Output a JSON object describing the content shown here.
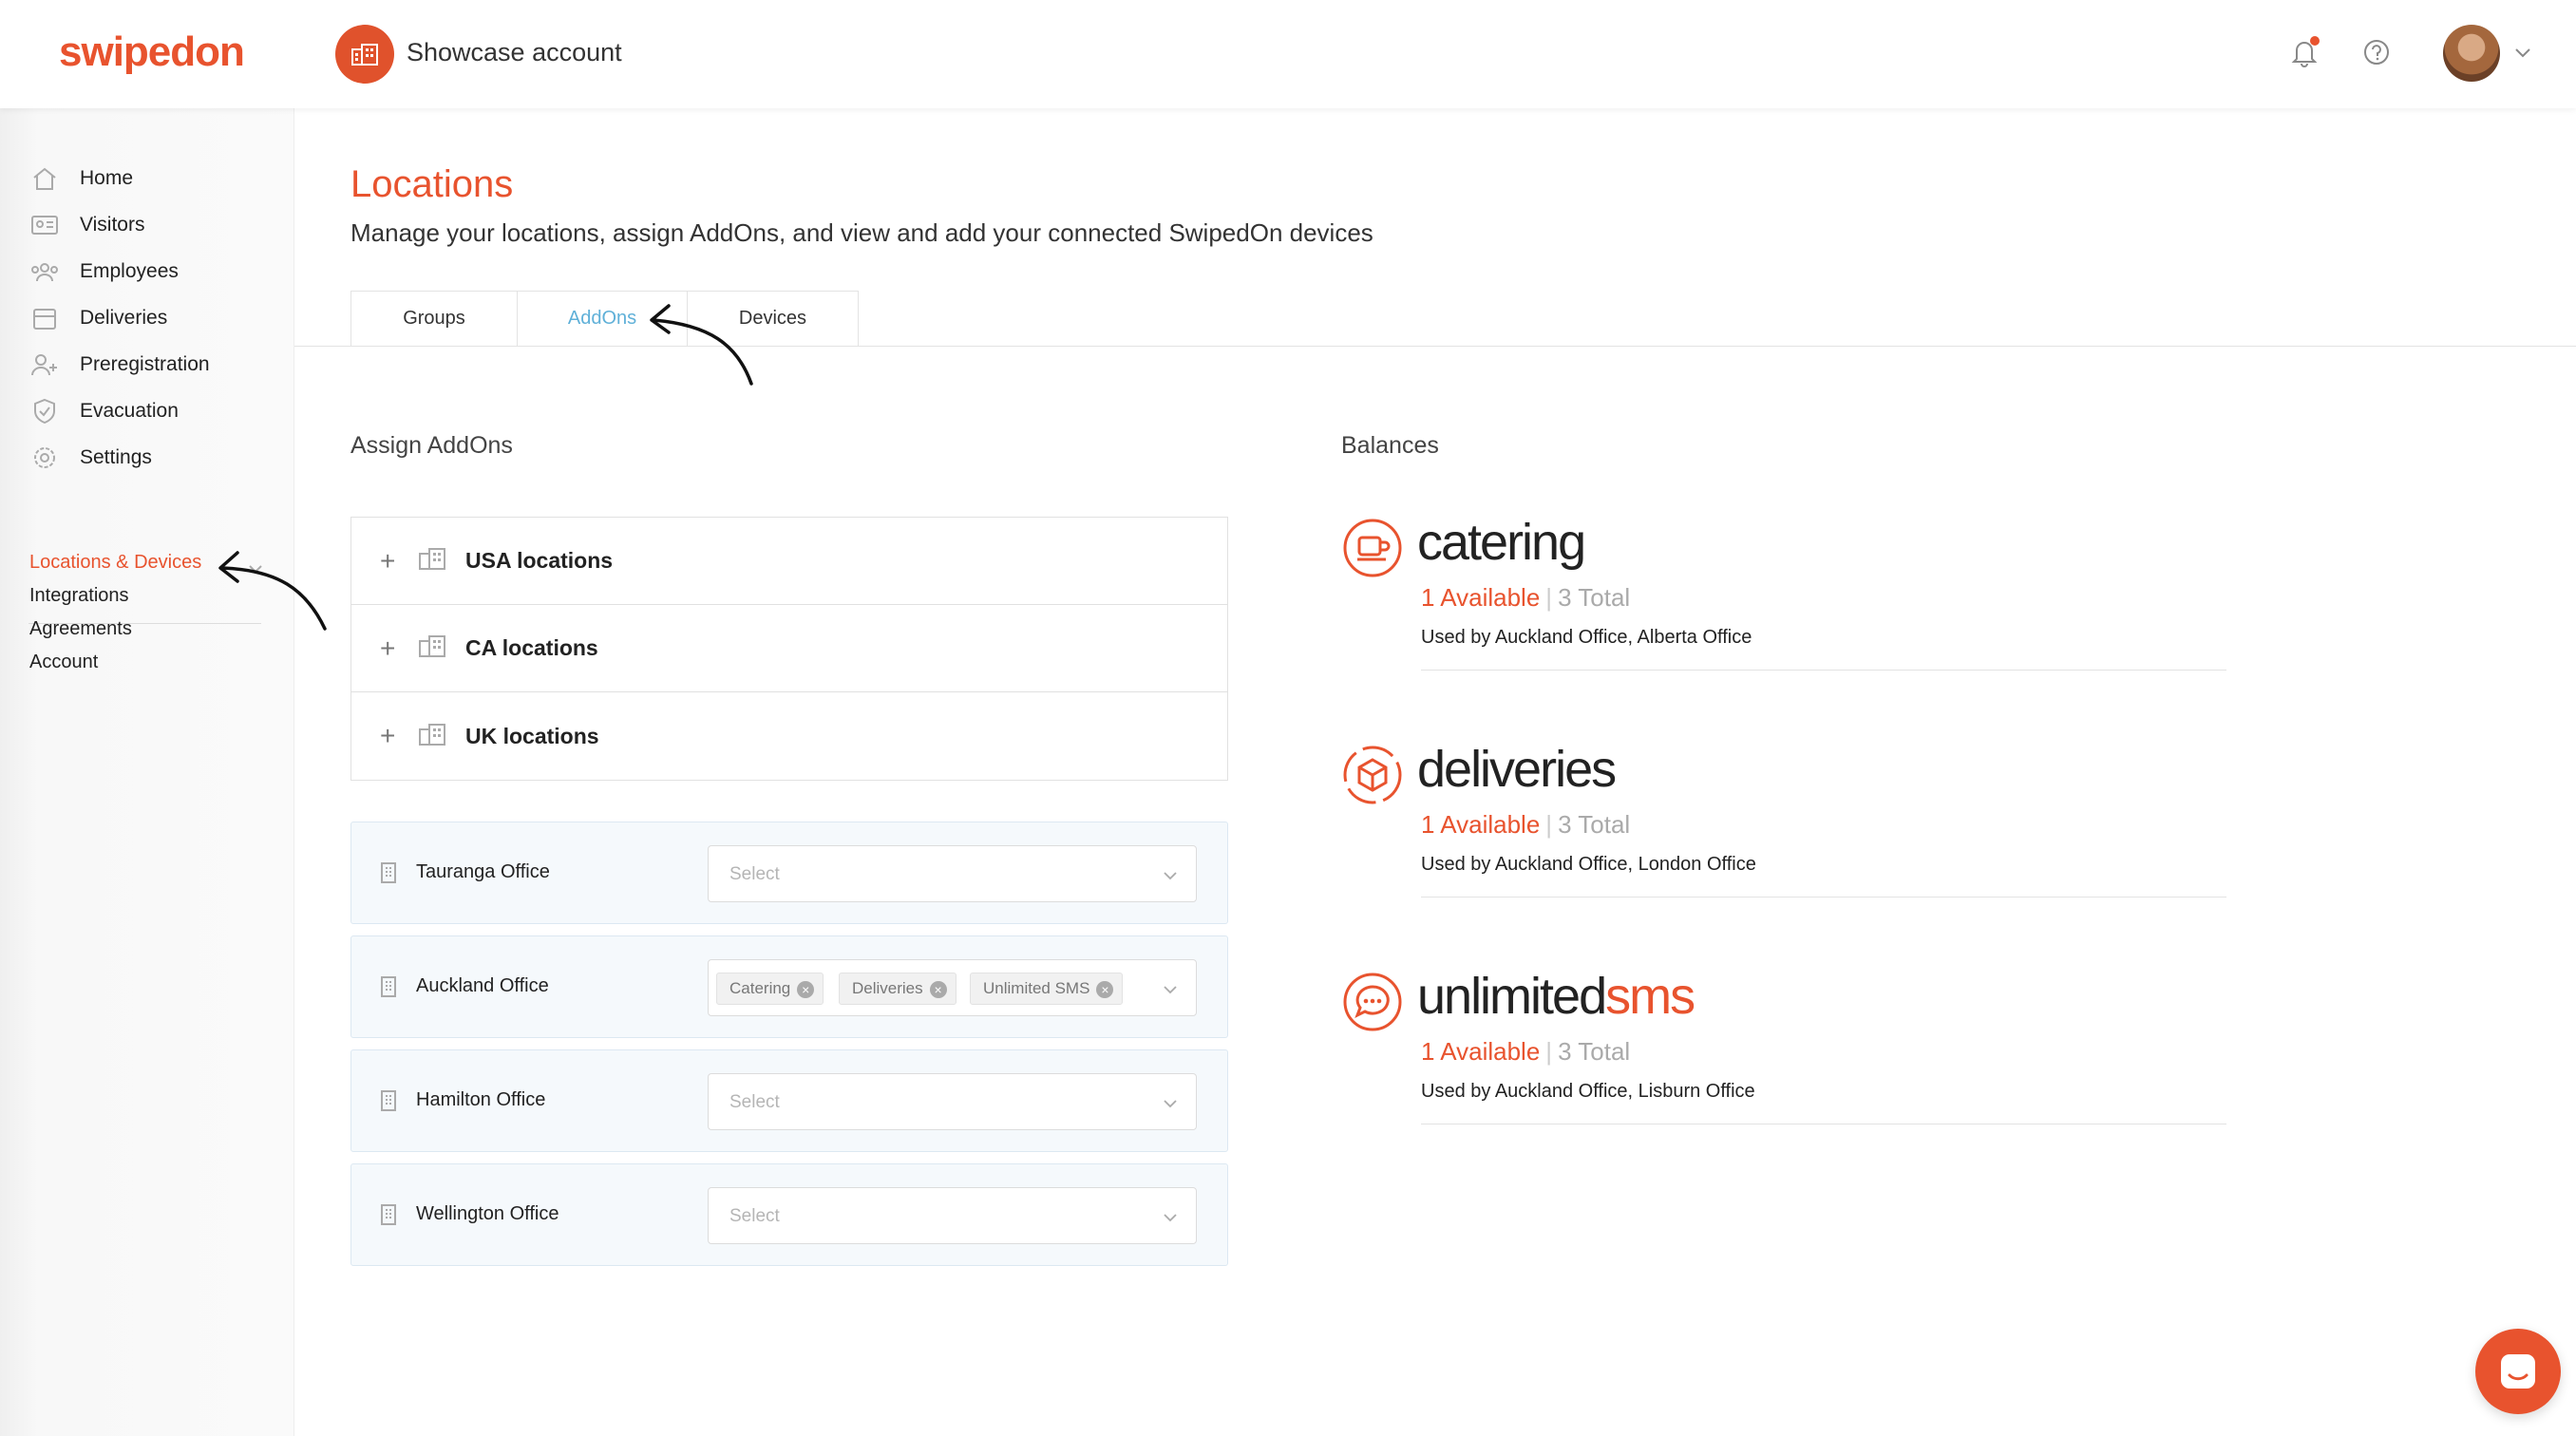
{
  "brand": {
    "logo_text": "swipedon",
    "accent": "#e8532e"
  },
  "header": {
    "account_name": "Showcase account"
  },
  "sidebar": {
    "items": [
      {
        "label": "Home",
        "icon": "home-icon"
      },
      {
        "label": "Visitors",
        "icon": "visitors-icon"
      },
      {
        "label": "Employees",
        "icon": "employees-icon"
      },
      {
        "label": "Deliveries",
        "icon": "deliveries-icon"
      },
      {
        "label": "Preregistration",
        "icon": "preregistration-icon"
      },
      {
        "label": "Evacuation",
        "icon": "evacuation-icon"
      },
      {
        "label": "Settings",
        "icon": "settings-icon"
      }
    ],
    "sub_items": [
      {
        "label": "Locations & Devices",
        "active": true
      },
      {
        "label": "Integrations"
      },
      {
        "label": "Agreements"
      },
      {
        "label": "Account"
      }
    ]
  },
  "page": {
    "title": "Locations",
    "subtitle": "Manage your locations, assign AddOns, and view and add your connected SwipedOn devices",
    "tabs": [
      {
        "label": "Groups"
      },
      {
        "label": "AddOns",
        "active": true
      },
      {
        "label": "Devices"
      }
    ]
  },
  "assign": {
    "heading": "Assign AddOns",
    "groups": [
      "USA locations",
      "CA locations",
      "UK locations"
    ],
    "offices": [
      {
        "name": "Tauranga Office",
        "placeholder": "Select",
        "selected": []
      },
      {
        "name": "Auckland Office",
        "placeholder": "",
        "selected": [
          "Catering",
          "Deliveries",
          "Unlimited SMS"
        ]
      },
      {
        "name": "Hamilton Office",
        "placeholder": "Select",
        "selected": []
      },
      {
        "name": "Wellington Office",
        "placeholder": "Select",
        "selected": []
      }
    ]
  },
  "balances": {
    "heading": "Balances",
    "items": [
      {
        "name_main": "catering",
        "name_accent": "",
        "available": "1 Available",
        "separator": "|",
        "total": "3 Total",
        "used_by": "Used by Auckland Office, Alberta Office",
        "icon": "catering-icon"
      },
      {
        "name_main": "deliveries",
        "name_accent": "",
        "available": "1 Available",
        "separator": "|",
        "total": "3 Total",
        "used_by": "Used by Auckland Office, London Office",
        "icon": "deliveries-addon-icon"
      },
      {
        "name_main": "unlimited",
        "name_accent": "sms",
        "available": "1 Available",
        "separator": "|",
        "total": "3 Total",
        "used_by": "Used by Auckland Office, Lisburn Office",
        "icon": "sms-icon"
      }
    ]
  }
}
